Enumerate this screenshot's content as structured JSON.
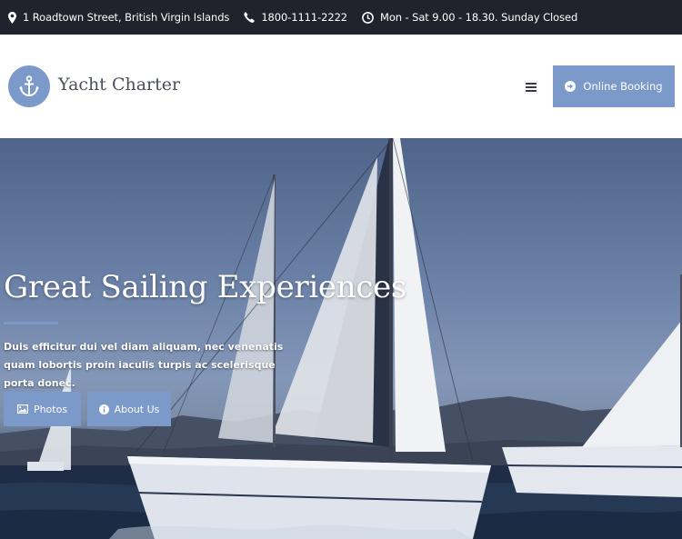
{
  "topbar": {
    "address": "1 Roadtown Street, British Virgin Islands",
    "phone": "1800-1111-2222",
    "hours": "Mon - Sat 9.00 - 18.30. Sunday Closed",
    "icons": [
      "map-marker-icon",
      "phone-icon",
      "clock-icon"
    ]
  },
  "header": {
    "logo_text": "Yacht Charter",
    "logo_icon": "anchor-icon",
    "menu_icon": "hamburger-menu-icon",
    "booking_label": "Online Booking",
    "booking_icon": "arrow-circle-right-icon"
  },
  "hero": {
    "title": "Great Sailing Experiences",
    "subtitle": "Duis efficitur dui vel diam aliquam, nec venenatis quam lobortis proin iaculis turpis ac scelerisque porta donec.",
    "buttons": [
      {
        "label": "Photos",
        "icon": "image-icon"
      },
      {
        "label": "About Us",
        "icon": "info-circle-icon"
      }
    ]
  },
  "colors": {
    "accent": "#7b9ac9",
    "topbar_bg": "#20222c",
    "header_bg": "#ffffff",
    "logo_text": "#4a4f5a"
  }
}
